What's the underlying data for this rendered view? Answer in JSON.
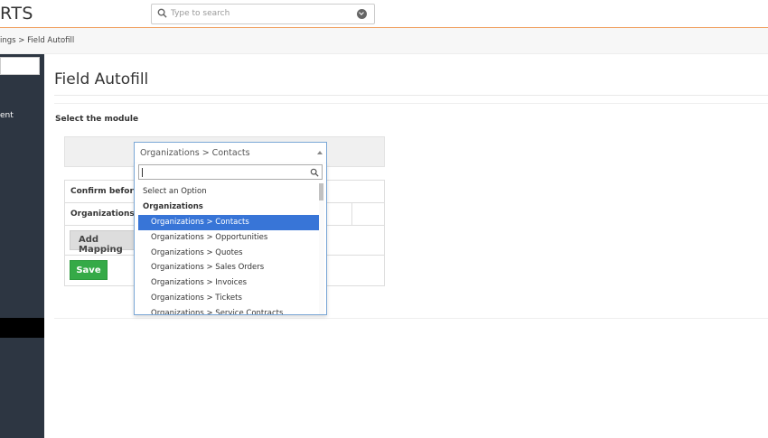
{
  "header": {
    "logo": "RTS",
    "search_placeholder": "Type to search"
  },
  "breadcrumb": "ings > Field Autofill",
  "sidebar": {
    "item_label": "ent"
  },
  "page": {
    "title": "Field Autofill",
    "select_module_label": "Select the module",
    "confirm_label": "Confirm before",
    "organizations_label": "Organizations",
    "add_mapping_label": "Add Mapping",
    "save_label": "Save"
  },
  "module_select": {
    "value": "Organizations > Contacts",
    "options": [
      {
        "label": "Select an Option",
        "kind": "option"
      },
      {
        "label": "Organizations",
        "kind": "group"
      },
      {
        "label": "Organizations > Contacts",
        "kind": "child",
        "selected": true
      },
      {
        "label": "Organizations > Opportunities",
        "kind": "child"
      },
      {
        "label": "Organizations > Quotes",
        "kind": "child"
      },
      {
        "label": "Organizations > Sales Orders",
        "kind": "child"
      },
      {
        "label": "Organizations > Invoices",
        "kind": "child"
      },
      {
        "label": "Organizations > Tickets",
        "kind": "child"
      },
      {
        "label": "Organizations > Service Contracts",
        "kind": "child"
      }
    ]
  },
  "colors": {
    "accent_line": "#f0a060",
    "sidebar_bg": "#2d3642",
    "selected_option": "#3875d7",
    "save_button": "#35aa47"
  }
}
